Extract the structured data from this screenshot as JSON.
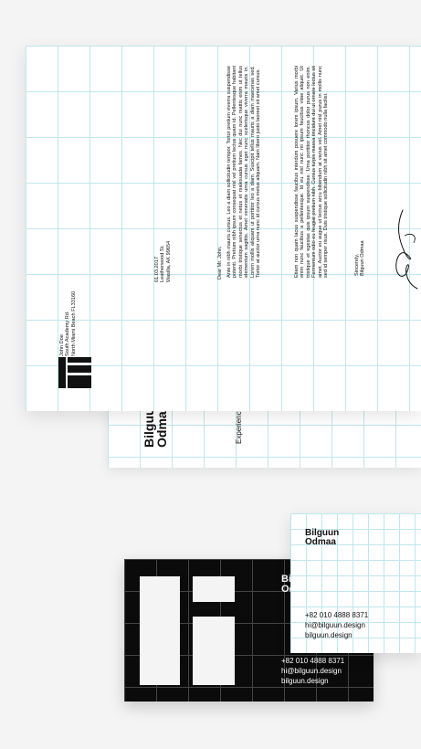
{
  "resume": {
    "name_line1": "Bilguun",
    "name_line2": "Odmaa",
    "section_label": "Experience"
  },
  "letter": {
    "sender_name": "John Doe",
    "sender_street": "South Academy Rd.",
    "sender_city": "North Miami Beach FL33160",
    "date": "01.03.2017",
    "recipient_street": "Leatherwood St.",
    "recipient_city": "Wasilla, AK 99654",
    "greeting": "Dear Mr. John,",
    "paragraph_1": "Ante in nibh mauris cursus. Leo a diam sollicitudin tempor. Tortor pretium viverra suspendisse potenti. Pretium nibh ipsum consequat nisl vel pretium lectus quam id. Pellentesque habitant morbi tristique senectus et netus et malesuada fames. Nec dui nunc mattis enim ut tellus elementum sagittis. Amet venenatis urna cursus eget nunc scelerisque viverra mauris in. Lorem mollis aliquam ut porttitor leo a diam. Suscipit tellus mauris a diam maecenas sed. Tortor at auctor urna nunc id cursus metus aliquam. Nam libero justo laoreet sit amet cursus.",
    "paragraph_2": "Etiam non quam lacus suspendisse faucibus interdum posuere lorem ipsum. Varius morbi enim nunc faucibus a pellentesque. Id eu nisl nunc mi ipsum faucibus vitae aliquet. Ut tristique et egestas quis ipsum suspendisse. Urna porttitor rhoncus dolor purus non enim. Fermentum odio eu feugiat pretium nibh. Cursus turpis massa tincidunt dui ut ornare lectus sit amet. Auctor eu augue ut lectus arcu bibendum at varius vel. Amet nisl purus in mollis nunc sed id semper risus. Duis tristique sollicitudin nibh sit amet commodo nulla facilisi.",
    "closing": "Sincerely,",
    "signer": "Bilguun Odmaa"
  },
  "card_black": {
    "name_line1": "Bilguun",
    "name_line2": "Odmaa",
    "phone": "+82 010 4888 8371",
    "email": "hi@bilguun.design",
    "website": "bilguun.design"
  },
  "card_white": {
    "name_line1": "Bilguun",
    "name_line2": "Odmaa",
    "phone": "+82 010 4888 8371",
    "email": "hi@bilguun.design",
    "website": "bilguun.design"
  },
  "colors": {
    "background": "#f4f4f4",
    "grid_line": "#bfe6ee",
    "ink": "#111111",
    "card_black": "#0b0b0b"
  }
}
